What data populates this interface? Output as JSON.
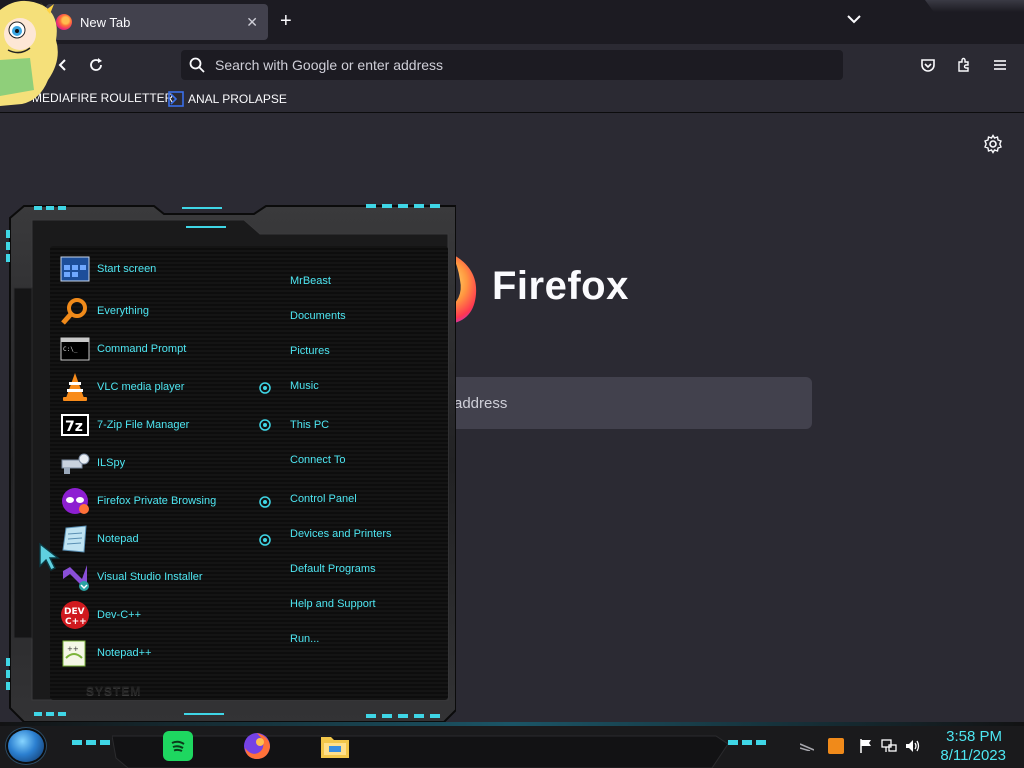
{
  "browser": {
    "tab": {
      "title": "New Tab",
      "close_glyph": "✕"
    },
    "new_tab_glyph": "+",
    "urlbar": {
      "placeholder": "Search with Google or enter address"
    },
    "bookmarks": [
      {
        "label": "MEDIAFIRE ROULETTER"
      },
      {
        "label": "ANAL PROLAPSE"
      }
    ],
    "icons": [
      "back-arrow-icon",
      "reload-icon",
      "search-icon",
      "pocket-icon",
      "extensions-icon",
      "menu-icon",
      "settings-gear-icon",
      "chevron-down-icon"
    ]
  },
  "newtab": {
    "brand": "Firefox",
    "search_placeholder_visible": "address"
  },
  "startmenu": {
    "programs": [
      {
        "label": "Start screen",
        "icon": "start-screen-icon"
      },
      {
        "label": "Everything",
        "icon": "everything-search-icon"
      },
      {
        "label": "Command Prompt",
        "icon": "command-prompt-icon"
      },
      {
        "label": "VLC media player",
        "icon": "vlc-cone-icon"
      },
      {
        "label": "7-Zip File Manager",
        "icon": "7zip-icon"
      },
      {
        "label": "ILSpy",
        "icon": "ilspy-icon"
      },
      {
        "label": "Firefox Private Browsing",
        "icon": "firefox-private-icon"
      },
      {
        "label": "Notepad",
        "icon": "notepad-icon"
      },
      {
        "label": "Visual Studio Installer",
        "icon": "visual-studio-installer-icon"
      },
      {
        "label": "Dev-C++",
        "icon": "dev-cpp-icon"
      },
      {
        "label": "Notepad++",
        "icon": "notepadpp-icon"
      }
    ],
    "places": [
      {
        "label": "MrBeast"
      },
      {
        "label": "Documents"
      },
      {
        "label": "Pictures"
      },
      {
        "label": "Music"
      },
      {
        "label": "This PC"
      },
      {
        "label": "Connect To"
      },
      {
        "label": "Control Panel"
      },
      {
        "label": "Devices and Printers"
      },
      {
        "label": "Default Programs"
      },
      {
        "label": "Help and Support"
      },
      {
        "label": "Run..."
      }
    ],
    "system_label": "SYSTEM",
    "accent": "#4ee6f2"
  },
  "taskbar": {
    "apps": [
      "spotify-icon",
      "firefox-icon",
      "file-explorer-icon"
    ],
    "tray": [
      "sublime-text-icon",
      "action-center-flag-icon",
      "network-icon",
      "volume-icon"
    ],
    "time": "3:58 PM",
    "date": "8/11/2023"
  }
}
